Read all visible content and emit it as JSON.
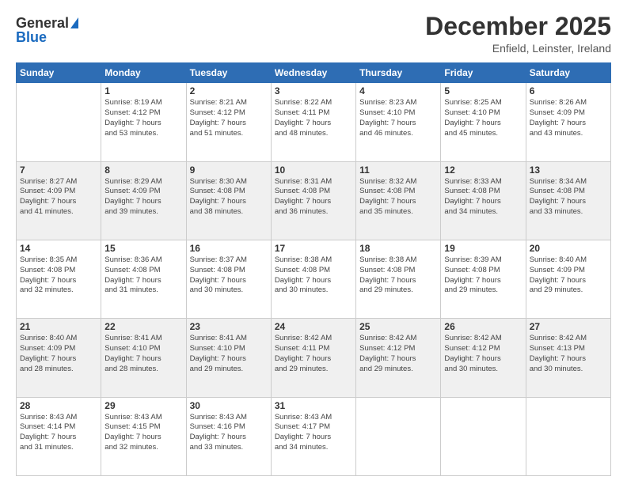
{
  "header": {
    "logo_general": "General",
    "logo_blue": "Blue",
    "month_title": "December 2025",
    "location": "Enfield, Leinster, Ireland"
  },
  "days_of_week": [
    "Sunday",
    "Monday",
    "Tuesday",
    "Wednesday",
    "Thursday",
    "Friday",
    "Saturday"
  ],
  "weeks": [
    [
      {
        "day": "",
        "info": ""
      },
      {
        "day": "1",
        "info": "Sunrise: 8:19 AM\nSunset: 4:12 PM\nDaylight: 7 hours\nand 53 minutes."
      },
      {
        "day": "2",
        "info": "Sunrise: 8:21 AM\nSunset: 4:12 PM\nDaylight: 7 hours\nand 51 minutes."
      },
      {
        "day": "3",
        "info": "Sunrise: 8:22 AM\nSunset: 4:11 PM\nDaylight: 7 hours\nand 48 minutes."
      },
      {
        "day": "4",
        "info": "Sunrise: 8:23 AM\nSunset: 4:10 PM\nDaylight: 7 hours\nand 46 minutes."
      },
      {
        "day": "5",
        "info": "Sunrise: 8:25 AM\nSunset: 4:10 PM\nDaylight: 7 hours\nand 45 minutes."
      },
      {
        "day": "6",
        "info": "Sunrise: 8:26 AM\nSunset: 4:09 PM\nDaylight: 7 hours\nand 43 minutes."
      }
    ],
    [
      {
        "day": "7",
        "info": "Sunrise: 8:27 AM\nSunset: 4:09 PM\nDaylight: 7 hours\nand 41 minutes."
      },
      {
        "day": "8",
        "info": "Sunrise: 8:29 AM\nSunset: 4:09 PM\nDaylight: 7 hours\nand 39 minutes."
      },
      {
        "day": "9",
        "info": "Sunrise: 8:30 AM\nSunset: 4:08 PM\nDaylight: 7 hours\nand 38 minutes."
      },
      {
        "day": "10",
        "info": "Sunrise: 8:31 AM\nSunset: 4:08 PM\nDaylight: 7 hours\nand 36 minutes."
      },
      {
        "day": "11",
        "info": "Sunrise: 8:32 AM\nSunset: 4:08 PM\nDaylight: 7 hours\nand 35 minutes."
      },
      {
        "day": "12",
        "info": "Sunrise: 8:33 AM\nSunset: 4:08 PM\nDaylight: 7 hours\nand 34 minutes."
      },
      {
        "day": "13",
        "info": "Sunrise: 8:34 AM\nSunset: 4:08 PM\nDaylight: 7 hours\nand 33 minutes."
      }
    ],
    [
      {
        "day": "14",
        "info": "Sunrise: 8:35 AM\nSunset: 4:08 PM\nDaylight: 7 hours\nand 32 minutes."
      },
      {
        "day": "15",
        "info": "Sunrise: 8:36 AM\nSunset: 4:08 PM\nDaylight: 7 hours\nand 31 minutes."
      },
      {
        "day": "16",
        "info": "Sunrise: 8:37 AM\nSunset: 4:08 PM\nDaylight: 7 hours\nand 30 minutes."
      },
      {
        "day": "17",
        "info": "Sunrise: 8:38 AM\nSunset: 4:08 PM\nDaylight: 7 hours\nand 30 minutes."
      },
      {
        "day": "18",
        "info": "Sunrise: 8:38 AM\nSunset: 4:08 PM\nDaylight: 7 hours\nand 29 minutes."
      },
      {
        "day": "19",
        "info": "Sunrise: 8:39 AM\nSunset: 4:08 PM\nDaylight: 7 hours\nand 29 minutes."
      },
      {
        "day": "20",
        "info": "Sunrise: 8:40 AM\nSunset: 4:09 PM\nDaylight: 7 hours\nand 29 minutes."
      }
    ],
    [
      {
        "day": "21",
        "info": "Sunrise: 8:40 AM\nSunset: 4:09 PM\nDaylight: 7 hours\nand 28 minutes."
      },
      {
        "day": "22",
        "info": "Sunrise: 8:41 AM\nSunset: 4:10 PM\nDaylight: 7 hours\nand 28 minutes."
      },
      {
        "day": "23",
        "info": "Sunrise: 8:41 AM\nSunset: 4:10 PM\nDaylight: 7 hours\nand 29 minutes."
      },
      {
        "day": "24",
        "info": "Sunrise: 8:42 AM\nSunset: 4:11 PM\nDaylight: 7 hours\nand 29 minutes."
      },
      {
        "day": "25",
        "info": "Sunrise: 8:42 AM\nSunset: 4:12 PM\nDaylight: 7 hours\nand 29 minutes."
      },
      {
        "day": "26",
        "info": "Sunrise: 8:42 AM\nSunset: 4:12 PM\nDaylight: 7 hours\nand 30 minutes."
      },
      {
        "day": "27",
        "info": "Sunrise: 8:42 AM\nSunset: 4:13 PM\nDaylight: 7 hours\nand 30 minutes."
      }
    ],
    [
      {
        "day": "28",
        "info": "Sunrise: 8:43 AM\nSunset: 4:14 PM\nDaylight: 7 hours\nand 31 minutes."
      },
      {
        "day": "29",
        "info": "Sunrise: 8:43 AM\nSunset: 4:15 PM\nDaylight: 7 hours\nand 32 minutes."
      },
      {
        "day": "30",
        "info": "Sunrise: 8:43 AM\nSunset: 4:16 PM\nDaylight: 7 hours\nand 33 minutes."
      },
      {
        "day": "31",
        "info": "Sunrise: 8:43 AM\nSunset: 4:17 PM\nDaylight: 7 hours\nand 34 minutes."
      },
      {
        "day": "",
        "info": ""
      },
      {
        "day": "",
        "info": ""
      },
      {
        "day": "",
        "info": ""
      }
    ]
  ]
}
